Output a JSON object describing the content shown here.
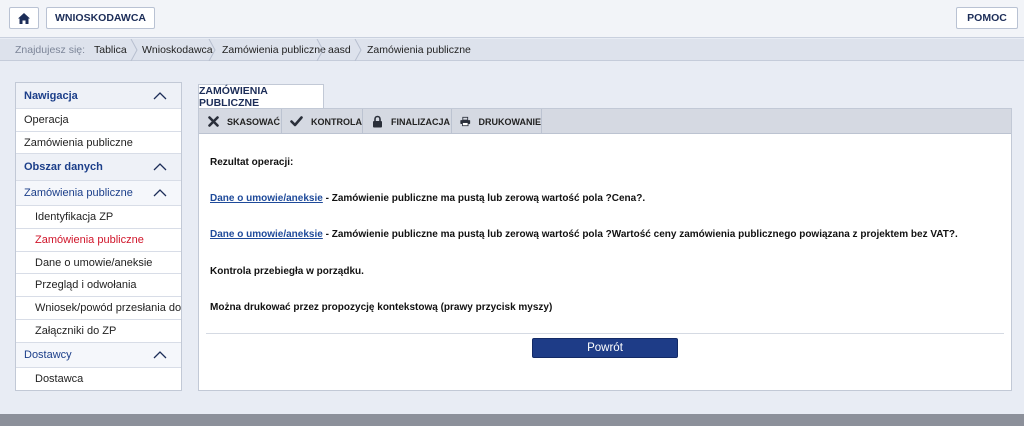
{
  "header": {
    "home_icon": "home-icon",
    "role_label": "WNIOSKODAWCA",
    "help_label": "POMOC"
  },
  "breadcrumb": {
    "lead": "Znajdujesz się:",
    "items": [
      "Tablica",
      "Wnioskodawca",
      "Zamówienia publiczne",
      "aasd",
      "Zamówienia publiczne"
    ]
  },
  "sidebar": {
    "nav_header": "Nawigacja",
    "nav_items": [
      "Operacja",
      "Zamówienia publiczne"
    ],
    "data_header": "Obszar danych",
    "zp_header": "Zamówienia publiczne",
    "zp_items": [
      "Identyfikacja ZP",
      "Zamówienia publiczne",
      "Dane o umowie/aneksie",
      "Przegląd i odwołania",
      "Wniosek/powód przesłania do UOKiK",
      "Załączniki do ZP"
    ],
    "supplier_header": "Dostawcy",
    "supplier_items": [
      "Dostawca"
    ]
  },
  "main": {
    "tab_label": "ZAMÓWIENIA PUBLICZNE",
    "toolbar": {
      "cancel": "SKASOWAĆ",
      "check": "KONTROLA",
      "finalize": "FINALIZACJA",
      "print": "DRUKOWANIE"
    },
    "result_label": "Rezultat operacji:",
    "messages": [
      {
        "link": "Dane o umowie/aneksie",
        "text": " - Zamówienie publiczne ma pustą lub zerową wartość pola ?Cena?."
      },
      {
        "link": "Dane o umowie/aneksie",
        "text": " - Zamówienie publiczne ma pustą lub zerową wartość pola ?Wartość ceny zamówienia publicznego powiązana z projektem bez VAT?."
      }
    ],
    "ok_text": "Kontrola przebiegła w porządku.",
    "print_hint": "Można drukować przez propozycję kontekstową (prawy przycisk myszy)",
    "back_label": "Powrót"
  },
  "colors": {
    "brand": "#1c2d58",
    "active": "#d0152a",
    "link": "#1e4a9a",
    "button": "#1e3c87"
  }
}
